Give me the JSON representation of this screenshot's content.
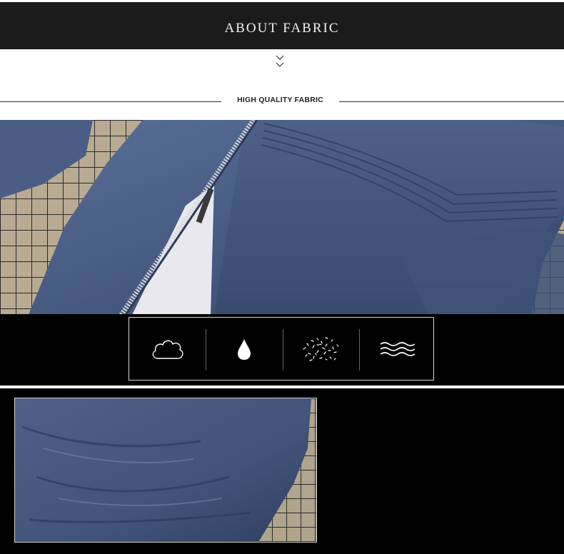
{
  "header": {
    "title": "ABOUT FABRIC"
  },
  "section": {
    "subtitle": "HIGH QUALITY FABRIC"
  },
  "features": [
    {
      "icon": "cloud-icon"
    },
    {
      "icon": "water-drop-icon"
    },
    {
      "icon": "fibers-icon"
    },
    {
      "icon": "waves-icon"
    }
  ],
  "colors": {
    "header_bg": "#1b1b1b",
    "band_bg": "#000000",
    "jacket_blue": "#4b5f86"
  }
}
